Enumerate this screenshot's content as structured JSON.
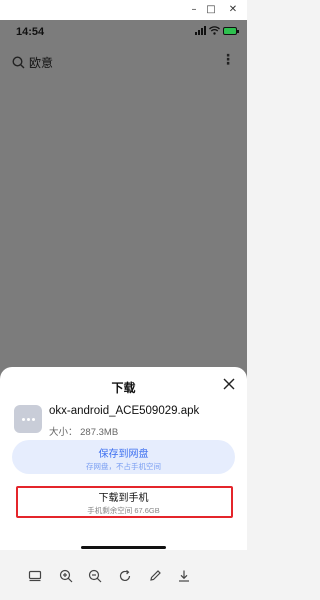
{
  "window": {
    "minimize_glyph": "–",
    "maximize_glyph": "□",
    "close_glyph": "✕"
  },
  "status_bar": {
    "time": "14:54"
  },
  "search": {
    "label": "欧意"
  },
  "sheet": {
    "title": "下载",
    "file": {
      "name": "okx-android_ACE509029.apk",
      "size": "大小： 287.3MB"
    },
    "cloud_button": {
      "label": "保存到网盘",
      "sublabel": "存网盘，不占手机空间"
    },
    "phone_button": {
      "label": "下载到手机",
      "sublabel": "手机剩余空间 67.6GB"
    }
  },
  "toolbar": {
    "icons": [
      "screenshot-icon",
      "zoom-in-icon",
      "zoom-out-icon",
      "rotate-icon",
      "edit-icon",
      "download-icon"
    ]
  },
  "colors": {
    "overlay": "#7c7c7c",
    "accent_blue": "#3b6ef0",
    "highlight_red": "#e4252b",
    "battery_green": "#2ec04f"
  }
}
